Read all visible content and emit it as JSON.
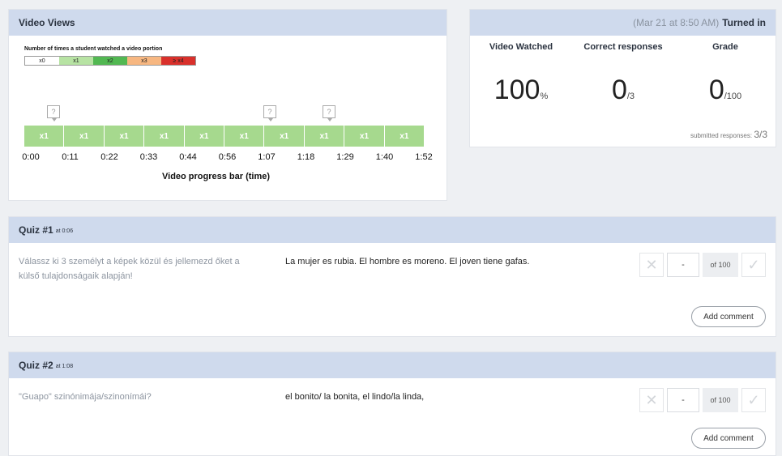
{
  "video_views": {
    "title": "Video Views",
    "caption": "Number of times a student watched a video portion",
    "legend": [
      {
        "label": "x0",
        "color": "#ffffff"
      },
      {
        "label": "x1",
        "color": "#b7e3a3"
      },
      {
        "label": "x2",
        "color": "#52b852"
      },
      {
        "label": "x3",
        "color": "#f7b781"
      },
      {
        "label": "≥ x4",
        "color": "#d9302b"
      }
    ],
    "segment_label": "x1",
    "segment_count": 10,
    "question_marker": "?",
    "ticks": [
      "0:00",
      "0:11",
      "0:22",
      "0:33",
      "0:44",
      "0:56",
      "1:07",
      "1:18",
      "1:29",
      "1:40",
      "1:52"
    ],
    "xlabel": "Video progress bar (time)"
  },
  "summary": {
    "timestamp": "(Mar 21 at 8:50 AM)",
    "status": "Turned in",
    "columns": [
      {
        "label": "Video Watched",
        "value": "100",
        "unit": "%"
      },
      {
        "label": "Correct responses",
        "value": "0",
        "unit": "/3"
      },
      {
        "label": "Grade",
        "value": "0",
        "unit": "/100"
      }
    ],
    "submitted_label": "submitted responses:",
    "submitted_value": "3/3"
  },
  "quizzes": [
    {
      "title": "Quiz #1",
      "at": "at 0:06",
      "prompt": "Válassz ki 3 személyt a képek közül és jellemezd őket a külső tulajdonságaik alapján!",
      "answer": "La mujer es rubia. El hombre es moreno. El joven tiene gafas.",
      "score": "-",
      "of": "of 100",
      "comment_label": "Add comment"
    },
    {
      "title": "Quiz #2",
      "at": "at 1:08",
      "prompt": "\"Guapo\" szinónimája/szinonímái?",
      "answer": "el bonito/ la bonita, el lindo/la linda,",
      "score": "-",
      "of": "of 100",
      "comment_label": "Add comment"
    }
  ],
  "icons": {
    "reject": "x-icon",
    "accept": "check-icon"
  }
}
